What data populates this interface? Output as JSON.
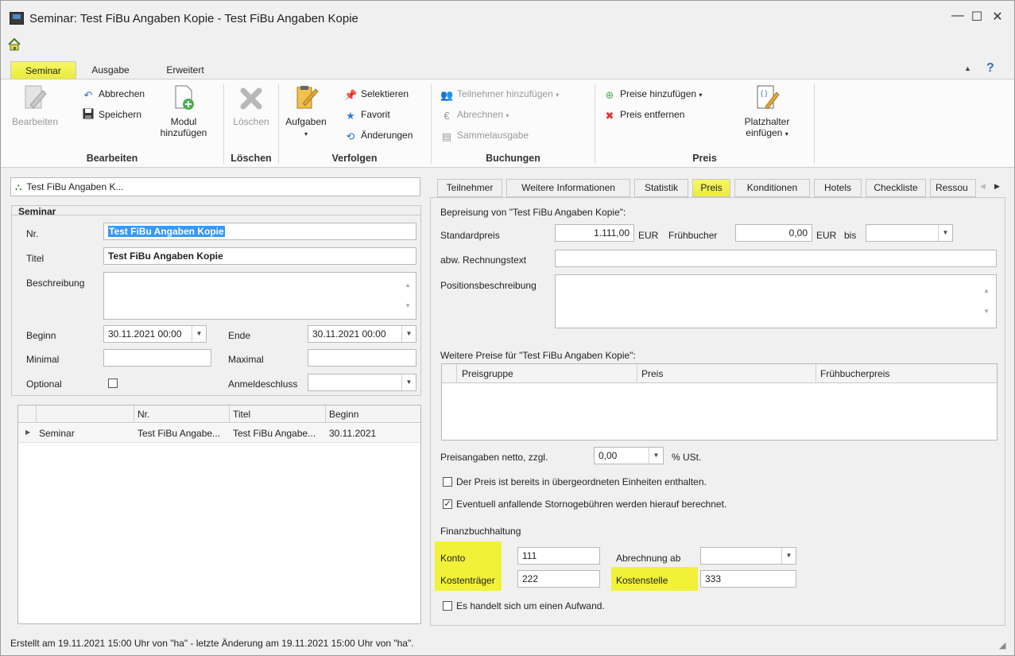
{
  "window": {
    "title": "Seminar: Test FiBu Angaben Kopie - Test FiBu Angaben Kopie",
    "minimize": "—",
    "maximize": "☐",
    "close": "✕"
  },
  "ribbon_tabs": [
    "Seminar",
    "Ausgabe",
    "Erweitert"
  ],
  "ribbon": {
    "bearbeiten": {
      "group": "Bearbeiten",
      "edit": "Bearbeiten",
      "cancel": "Abbrechen",
      "save": "Speichern",
      "add_module_1": "Modul",
      "add_module_2": "hinzufügen"
    },
    "loeschen": {
      "group": "Löschen",
      "delete": "Löschen"
    },
    "verfolgen": {
      "group": "Verfolgen",
      "tasks": "Aufgaben",
      "select": "Selektieren",
      "favorite": "Favorit",
      "changes": "Änderungen"
    },
    "buchungen": {
      "group": "Buchungen",
      "add_participants": "Teilnehmer hinzufügen",
      "bill": "Abrechnen",
      "batch": "Sammelausgabe"
    },
    "preis": {
      "group": "Preis",
      "add_prices": "Preise hinzufügen",
      "remove_price": "Preis entfernen",
      "placeholder_1": "Platzhalter",
      "placeholder_2": "einfügen"
    }
  },
  "tree_node": "Test FiBu Angaben K...",
  "seminar": {
    "section": "Seminar",
    "nr_label": "Nr.",
    "nr_value": "Test FiBu Angaben Kopie",
    "titel_label": "Titel",
    "titel_value": "Test FiBu Angaben Kopie",
    "beschreibung_label": "Beschreibung",
    "beginn_label": "Beginn",
    "beginn_value": "30.11.2021 00:00",
    "ende_label": "Ende",
    "ende_value": "30.11.2021 00:00",
    "minimal_label": "Minimal",
    "maximal_label": "Maximal",
    "optional_label": "Optional",
    "anmeldeschluss_label": "Anmeldeschluss"
  },
  "tree_grid": {
    "columns": [
      "Nr.",
      "Titel",
      "Beginn"
    ],
    "rows": [
      {
        "type": "Seminar",
        "nr": "Test FiBu Angabe...",
        "titel": "Test FiBu Angabe...",
        "beginn": "30.11.2021"
      }
    ]
  },
  "detail_tabs": [
    "Teilnehmer",
    "Weitere Informationen",
    "Statistik",
    "Preis",
    "Konditionen",
    "Hotels",
    "Checkliste",
    "Ressou"
  ],
  "preis": {
    "heading": "Bepreisung von \"Test FiBu Angaben Kopie\":",
    "standardpreis_label": "Standardpreis",
    "standardpreis_value": "1.111,00",
    "eur": "EUR",
    "fruehbucher_label": "Frühbucher",
    "fruehbucher_value": "0,00",
    "bis_label": "bis",
    "rechnungstext_label": "abw. Rechnungstext",
    "positionsbeschreibung_label": "Positionsbeschreibung",
    "weitere_heading": "Weitere Preise für \"Test FiBu Angaben Kopie\":",
    "grid_columns": [
      "Preisgruppe",
      "Preis",
      "Frühbucherpreis"
    ],
    "netto_label": "Preisangaben netto, zzgl.",
    "ust_value": "0,00",
    "ust_label": "% USt.",
    "check1_label": "Der Preis ist bereits in übergeordneten Einheiten enthalten.",
    "check2_label": "Eventuell anfallende Stornogebühren werden hierauf berechnet.",
    "fibu_heading": "Finanzbuchhaltung",
    "konto_label": "Konto",
    "konto_value": "111",
    "abrechnung_label": "Abrechnung ab",
    "kostentraeger_label": "Kostenträger",
    "kostentraeger_value": "222",
    "kostenstelle_label": "Kostenstelle",
    "kostenstelle_value": "333",
    "aufwand_label": "Es handelt sich um einen Aufwand."
  },
  "status": "Erstellt am 19.11.2021 15:00 Uhr von \"ha\" - letzte Änderung am 19.11.2021 15:00 Uhr von \"ha\".",
  "colors": {
    "highlight": "#f1f13a",
    "selection": "#3399ff",
    "accent_blue": "#2f6fc0"
  }
}
